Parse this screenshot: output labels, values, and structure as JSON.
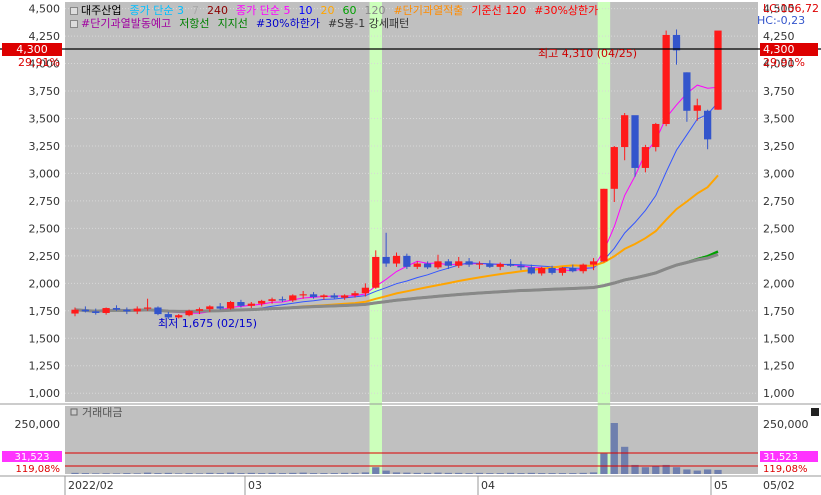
{
  "title": "대주산업",
  "legend_row1": [
    {
      "text": "종가 단순 3",
      "color": "#00bfff"
    },
    {
      "text": "7",
      "color": "#aaaaaa"
    },
    {
      "text": "240",
      "color": "#8b0000"
    },
    {
      "text": "종가 단순 5",
      "color": "#ff00ff"
    },
    {
      "text": "10",
      "color": "#0000ff"
    },
    {
      "text": "20",
      "color": "#ffa500"
    },
    {
      "text": "60",
      "color": "#00a000"
    },
    {
      "text": "120",
      "color": "#888888"
    },
    {
      "text": "#단기과열적출",
      "color": "#ff8c00"
    },
    {
      "text": "기준선 120",
      "color": "#ff0000"
    },
    {
      "text": "#30%상한가",
      "color": "#ff0000"
    }
  ],
  "legend_row2": [
    {
      "text": "#단기과열발동예고",
      "color": "#a000a0"
    },
    {
      "text": "저항선",
      "color": "#008000"
    },
    {
      "text": "지지선",
      "color": "#008000"
    },
    {
      "text": "#30%하한가",
      "color": "#0000cc"
    },
    {
      "text": "#S봉-1 강세패턴",
      "color": "#333333"
    }
  ],
  "lc_label": "LC:156,72",
  "hc_label": "HC:-0,23",
  "price_tag": "4,300",
  "price_pct": "29,91%",
  "annotations": {
    "high": "최고 4,310 (04/25)",
    "low": "최저 1,675 (02/15)"
  },
  "volume_label": "거래대금",
  "volume_tag": "31,523",
  "volume_pct": "119,08%",
  "colors": {
    "up": "#ff1a1a",
    "down": "#3355cc",
    "highlight": "#ccffbb",
    "bg": "#c0c0c0"
  },
  "chart_data": {
    "type": "candlestick",
    "y_ticks": [
      "4,500",
      "4,250",
      "4,000",
      "3,750",
      "3,500",
      "3,250",
      "3,000",
      "2,750",
      "2,500",
      "2,250",
      "2,000",
      "1,750",
      "1,500",
      "1,250",
      "1,000"
    ],
    "ylim": [
      920,
      4560
    ],
    "x_labels": [
      "2022/02",
      "03",
      "04",
      "05",
      "05/02"
    ],
    "candles": [
      [
        1725,
        1780,
        1700,
        1760
      ],
      [
        1760,
        1790,
        1735,
        1745
      ],
      [
        1745,
        1770,
        1715,
        1730
      ],
      [
        1730,
        1780,
        1715,
        1775
      ],
      [
        1775,
        1800,
        1750,
        1760
      ],
      [
        1760,
        1780,
        1720,
        1745
      ],
      [
        1745,
        1790,
        1720,
        1770
      ],
      [
        1770,
        1860,
        1750,
        1780
      ],
      [
        1780,
        1790,
        1710,
        1720
      ],
      [
        1720,
        1740,
        1675,
        1690
      ],
      [
        1690,
        1720,
        1680,
        1710
      ],
      [
        1710,
        1760,
        1700,
        1750
      ],
      [
        1750,
        1780,
        1720,
        1765
      ],
      [
        1765,
        1800,
        1740,
        1790
      ],
      [
        1790,
        1820,
        1760,
        1770
      ],
      [
        1770,
        1840,
        1760,
        1830
      ],
      [
        1830,
        1850,
        1780,
        1795
      ],
      [
        1795,
        1830,
        1775,
        1815
      ],
      [
        1815,
        1850,
        1790,
        1840
      ],
      [
        1840,
        1870,
        1815,
        1855
      ],
      [
        1855,
        1880,
        1830,
        1845
      ],
      [
        1845,
        1900,
        1830,
        1890
      ],
      [
        1890,
        1930,
        1860,
        1900
      ],
      [
        1900,
        1920,
        1860,
        1875
      ],
      [
        1875,
        1900,
        1850,
        1890
      ],
      [
        1890,
        1910,
        1860,
        1870
      ],
      [
        1870,
        1900,
        1850,
        1890
      ],
      [
        1890,
        1930,
        1870,
        1910
      ],
      [
        1910,
        2000,
        1880,
        1960
      ],
      [
        1960,
        2300,
        1950,
        2240
      ],
      [
        2240,
        2460,
        2150,
        2180
      ],
      [
        2180,
        2280,
        2150,
        2250
      ],
      [
        2250,
        2270,
        2130,
        2150
      ],
      [
        2150,
        2200,
        2130,
        2180
      ],
      [
        2180,
        2200,
        2130,
        2145
      ],
      [
        2145,
        2260,
        2130,
        2200
      ],
      [
        2200,
        2220,
        2130,
        2160
      ],
      [
        2160,
        2240,
        2140,
        2200
      ],
      [
        2200,
        2230,
        2150,
        2170
      ],
      [
        2170,
        2200,
        2130,
        2180
      ],
      [
        2180,
        2210,
        2140,
        2150
      ],
      [
        2150,
        2190,
        2120,
        2175
      ],
      [
        2175,
        2220,
        2150,
        2160
      ],
      [
        2160,
        2200,
        2120,
        2145
      ],
      [
        2145,
        2170,
        2080,
        2090
      ],
      [
        2090,
        2150,
        2070,
        2140
      ],
      [
        2140,
        2160,
        2080,
        2095
      ],
      [
        2095,
        2150,
        2070,
        2140
      ],
      [
        2140,
        2170,
        2100,
        2110
      ],
      [
        2110,
        2180,
        2090,
        2170
      ],
      [
        2170,
        2230,
        2120,
        2200
      ],
      [
        2200,
        2860,
        2190,
        2860
      ],
      [
        2860,
        3250,
        2740,
        3240
      ],
      [
        3240,
        3550,
        3120,
        3530
      ],
      [
        3530,
        3500,
        2970,
        3050
      ],
      [
        3050,
        3260,
        3010,
        3240
      ],
      [
        3240,
        3460,
        3200,
        3450
      ],
      [
        3450,
        4300,
        3430,
        4260
      ],
      [
        4260,
        4310,
        3990,
        4120
      ],
      [
        3920,
        3920,
        3470,
        3570
      ],
      [
        3570,
        3680,
        3480,
        3620
      ],
      [
        3570,
        3580,
        3220,
        3310
      ],
      [
        3580,
        3900,
        3580,
        4300
      ]
    ],
    "highlight_indices": [
      29,
      51
    ],
    "volume_ylim": [
      0,
      300000
    ],
    "volume_ticks": [
      "250,000"
    ],
    "volume": [
      5000,
      4000,
      3000,
      3500,
      3000,
      4000,
      3000,
      6000,
      4000,
      5000,
      3000,
      4000,
      3000,
      5000,
      4000,
      6000,
      4000,
      5000,
      4000,
      5000,
      4000,
      5000,
      6000,
      4000,
      4000,
      4000,
      5000,
      5000,
      7000,
      30000,
      15000,
      7000,
      6000,
      5000,
      5000,
      6000,
      5000,
      5000,
      4000,
      5000,
      4000,
      4000,
      5000,
      4000,
      5000,
      4000,
      4000,
      4000,
      4000,
      5000,
      7000,
      90000,
      225000,
      120000,
      40000,
      30000,
      35000,
      40000,
      30000,
      20000,
      15000,
      20000,
      18000
    ]
  }
}
